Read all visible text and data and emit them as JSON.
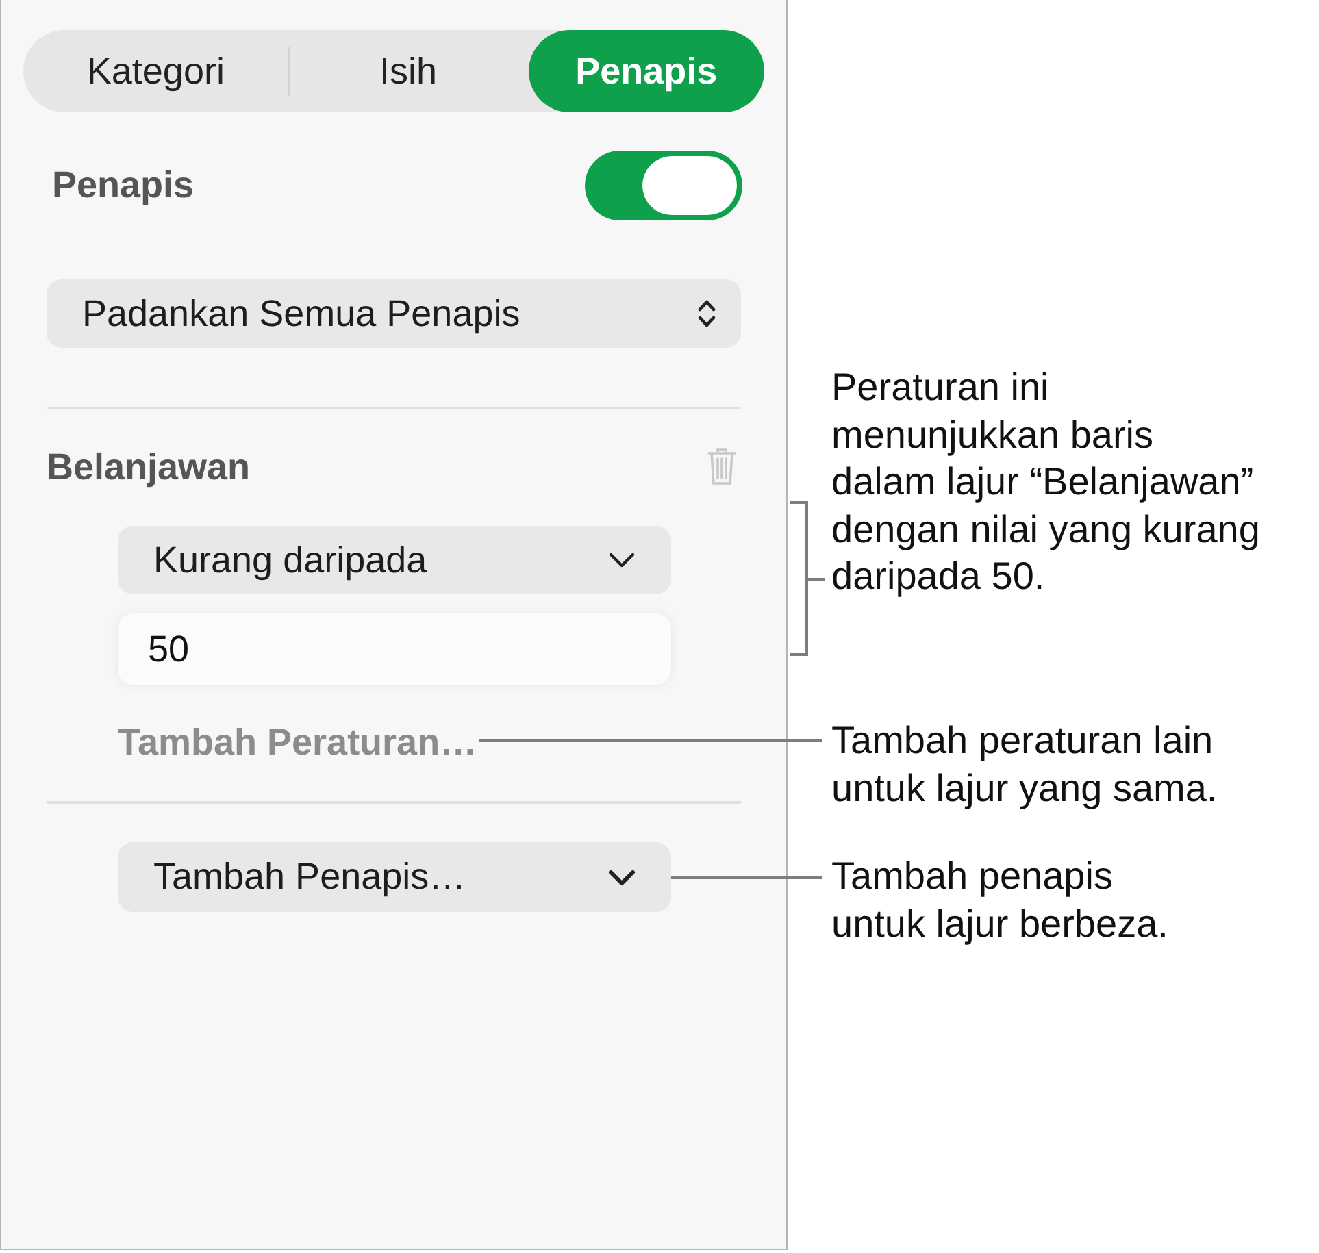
{
  "tabs": [
    {
      "label": "Kategori",
      "selected": false
    },
    {
      "label": "Isih",
      "selected": false
    },
    {
      "label": "Penapis",
      "selected": true
    }
  ],
  "filter_toggle": {
    "label": "Penapis",
    "on": true
  },
  "match_menu": {
    "value": "Padankan Semua Penapis"
  },
  "filters": [
    {
      "column": "Belanjawan",
      "rules": [
        {
          "condition": "Kurang daripada",
          "value": "50"
        }
      ],
      "add_rule": "Tambah Peraturan…"
    }
  ],
  "add_filter": {
    "label": "Tambah Penapis…"
  },
  "callouts": [
    {
      "kind": "bracket",
      "text": "Peraturan ini\nmenunjukkan baris\ndalam lajur “Belanjawan”\ndengan nilai yang kurang\ndaripada 50."
    },
    {
      "kind": "line",
      "text": "Tambah peraturan lain\nuntuk lajur yang sama."
    },
    {
      "kind": "line",
      "text": "Tambah penapis\nuntuk lajur berbeza."
    }
  ]
}
